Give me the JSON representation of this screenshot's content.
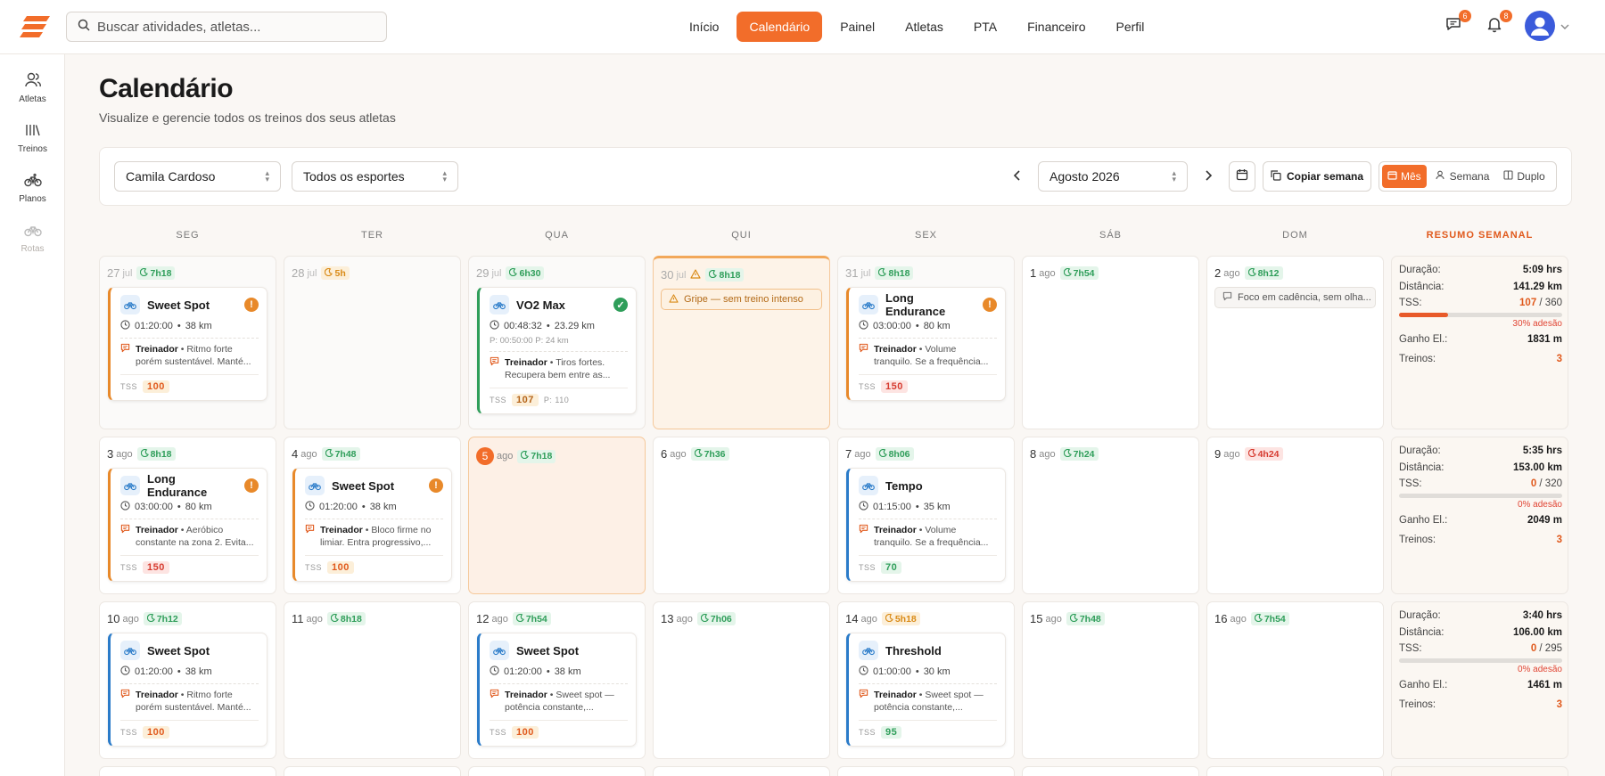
{
  "header": {
    "search_placeholder": "Buscar atividades, atletas...",
    "nav": [
      "Início",
      "Calendário",
      "Painel",
      "Atletas",
      "PTA",
      "Financeiro",
      "Perfil"
    ],
    "active_nav": "Calendário",
    "messages_badge": "6",
    "notifications_badge": "8"
  },
  "sidebar": {
    "items": [
      {
        "label": "Atletas",
        "icon": "users-icon"
      },
      {
        "label": "Treinos",
        "icon": "library-icon"
      },
      {
        "label": "Planos",
        "icon": "bike-icon"
      },
      {
        "label": "Rotas",
        "icon": "bike-icon"
      }
    ]
  },
  "page": {
    "title": "Calendário",
    "subtitle": "Visualize e gerencie todos os treinos dos seus atletas"
  },
  "toolbar": {
    "athlete": "Camila Cardoso",
    "sport": "Todos os esportes",
    "month": "Agosto 2026",
    "copy_week": "Copiar semana",
    "views": [
      "Mês",
      "Semana",
      "Duplo"
    ],
    "active_view": "Mês"
  },
  "weekdays": [
    "SEG",
    "TER",
    "QUA",
    "QUI",
    "SEX",
    "SÁB",
    "DOM"
  ],
  "summary_header": "RESUMO SEMANAL",
  "labels": {
    "tss": "TSS",
    "coach": "Treinador",
    "duration": "Duração:",
    "distance": "Distância:",
    "tss_label": "TSS:",
    "elevation": "Ganho El.:",
    "workouts": "Treinos:",
    "sick": "Gripe — sem treino intenso",
    "focus_note": "Foco em cadência, sem olha..."
  },
  "weeks": [
    {
      "days": [
        {
          "n": "27",
          "m": "jul",
          "h": "7h18",
          "hc": "green",
          "past": true,
          "card": {
            "name": "Sweet Spot",
            "status": "warn",
            "dur": "01:20:00",
            "dist": "38 km",
            "note": "Ritmo forte porém sustentável. Manté...",
            "tss": "100",
            "tc": "orange",
            "bc": "orange"
          }
        },
        {
          "n": "28",
          "m": "jul",
          "h": "5h",
          "hc": "orange",
          "past": true
        },
        {
          "n": "29",
          "m": "jul",
          "h": "6h30",
          "hc": "green",
          "past": true,
          "card": {
            "name": "VO2 Max",
            "status": "ok",
            "dur": "00:48:32",
            "dist": "23.29 km",
            "plan": "P: 00:50:00   P: 24 km",
            "note": "Tiros fortes. Recupera bem entre as...",
            "tss": "107",
            "tc": "ob",
            "tss_plan": "P: 110",
            "bc": "green"
          }
        },
        {
          "n": "30",
          "m": "jul",
          "h": "8h18",
          "hc": "green",
          "past": true,
          "sick": true
        },
        {
          "n": "31",
          "m": "jul",
          "h": "8h18",
          "hc": "green",
          "past": true,
          "card": {
            "name": "Long Endurance",
            "status": "warn",
            "dur": "03:00:00",
            "dist": "80 km",
            "note": "Volume tranquilo. Se a frequência...",
            "tss": "150",
            "tc": "red",
            "bc": "orange"
          }
        },
        {
          "n": "1",
          "m": "ago",
          "h": "7h54",
          "hc": "green"
        },
        {
          "n": "2",
          "m": "ago",
          "h": "8h12",
          "hc": "green",
          "note": true
        }
      ],
      "summary": {
        "dur": "5:09 hrs",
        "dist": "141.29 km",
        "tss": "107",
        "tss_plan": "/ 360",
        "fill": 0.3,
        "adh": "30% adesão",
        "elev": "1831 m",
        "count": "3"
      }
    },
    {
      "days": [
        {
          "n": "3",
          "m": "ago",
          "h": "8h18",
          "hc": "green",
          "card": {
            "name": "Long Endurance",
            "status": "warn",
            "dur": "03:00:00",
            "dist": "80 km",
            "note": "Aeróbico constante na zona 2. Evita...",
            "tss": "150",
            "tc": "red",
            "bc": "orange"
          }
        },
        {
          "n": "4",
          "m": "ago",
          "h": "7h48",
          "hc": "green",
          "card": {
            "name": "Sweet Spot",
            "status": "warn",
            "dur": "01:20:00",
            "dist": "38 km",
            "note": "Bloco firme no limiar. Entra progressivo,...",
            "tss": "100",
            "tc": "orange",
            "bc": "orange"
          }
        },
        {
          "n": "5",
          "m": "ago",
          "h": "7h18",
          "hc": "green",
          "today": true
        },
        {
          "n": "6",
          "m": "ago",
          "h": "7h36",
          "hc": "green"
        },
        {
          "n": "7",
          "m": "ago",
          "h": "8h06",
          "hc": "green",
          "card": {
            "name": "Tempo",
            "dur": "01:15:00",
            "dist": "35 km",
            "note": "Volume tranquilo. Se a frequência...",
            "tss": "70",
            "tc": "green",
            "bc": "blue"
          }
        },
        {
          "n": "8",
          "m": "ago",
          "h": "7h24",
          "hc": "green"
        },
        {
          "n": "9",
          "m": "ago",
          "h": "4h24",
          "hc": "red"
        }
      ],
      "summary": {
        "dur": "5:35 hrs",
        "dist": "153.00 km",
        "tss": "0",
        "tss_plan": "/ 320",
        "fill": 0,
        "adh": "0% adesão",
        "elev": "2049 m",
        "count": "3"
      }
    },
    {
      "days": [
        {
          "n": "10",
          "m": "ago",
          "h": "7h12",
          "hc": "green",
          "card": {
            "name": "Sweet Spot",
            "dur": "01:20:00",
            "dist": "38 km",
            "note": "Ritmo forte porém sustentável. Manté...",
            "tss": "100",
            "tc": "orange",
            "bc": "blue"
          }
        },
        {
          "n": "11",
          "m": "ago",
          "h": "8h18",
          "hc": "green"
        },
        {
          "n": "12",
          "m": "ago",
          "h": "7h54",
          "hc": "green",
          "card": {
            "name": "Sweet Spot",
            "dur": "01:20:00",
            "dist": "38 km",
            "note": "Sweet spot — potência constante,...",
            "tss": "100",
            "tc": "orange",
            "bc": "blue"
          }
        },
        {
          "n": "13",
          "m": "ago",
          "h": "7h06",
          "hc": "green"
        },
        {
          "n": "14",
          "m": "ago",
          "h": "5h18",
          "hc": "orange",
          "card": {
            "name": "Threshold",
            "dur": "01:00:00",
            "dist": "30 km",
            "note": "Sweet spot — potência constante,...",
            "tss": "95",
            "tc": "green",
            "bc": "blue"
          }
        },
        {
          "n": "15",
          "m": "ago",
          "h": "7h48",
          "hc": "green"
        },
        {
          "n": "16",
          "m": "ago",
          "h": "7h54",
          "hc": "green"
        }
      ],
      "summary": {
        "dur": "3:40 hrs",
        "dist": "106.00 km",
        "tss": "0",
        "tss_plan": "/ 295",
        "fill": 0,
        "adh": "0% adesão",
        "elev": "1461 m",
        "count": "3"
      }
    }
  ]
}
